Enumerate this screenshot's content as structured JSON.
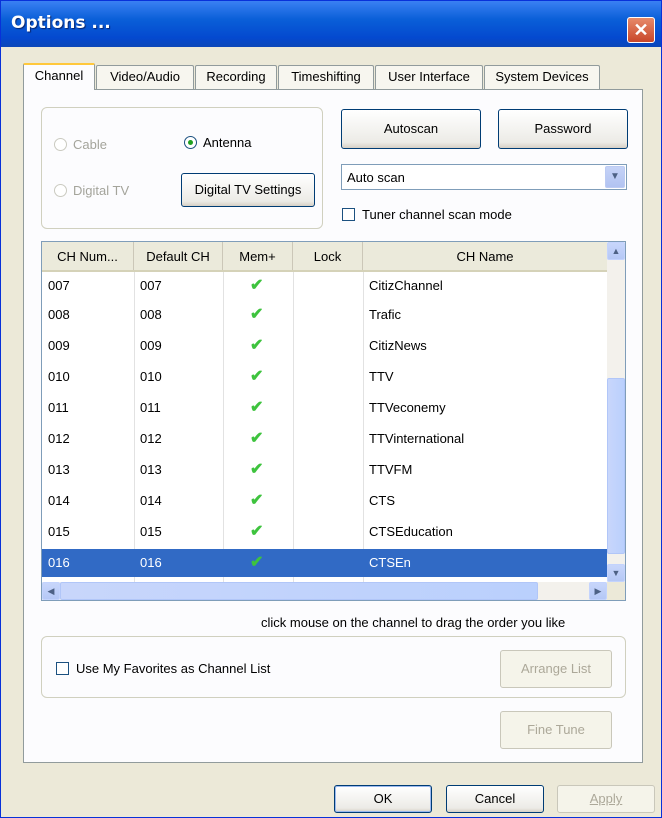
{
  "window": {
    "title": "Options ..."
  },
  "tabs": [
    "Channel",
    "Video/Audio",
    "Recording",
    "Timeshifting",
    "User Interface",
    "System Devices"
  ],
  "source": {
    "cable_label": "Cable",
    "antenna_label": "Antenna",
    "digital_tv_label": "Digital TV",
    "selected": "Antenna",
    "digital_tv_settings_label": "Digital TV Settings"
  },
  "buttons": {
    "autoscan": "Autoscan",
    "password": "Password",
    "arrange_list": "Arrange List",
    "fine_tune": "Fine Tune",
    "ok": "OK",
    "cancel": "Cancel",
    "apply": "Apply"
  },
  "scan": {
    "mode_value": "Auto scan",
    "tuner_scan_label": "Tuner channel scan mode"
  },
  "list": {
    "columns": [
      "CH Num...",
      "Default CH",
      "Mem+",
      "Lock",
      "CH Name"
    ],
    "rows": [
      {
        "ch": "007",
        "default": "007",
        "mem": true,
        "lock": "",
        "name": "CitizChannel"
      },
      {
        "ch": "008",
        "default": "008",
        "mem": true,
        "lock": "",
        "name": "Trafic"
      },
      {
        "ch": "009",
        "default": "009",
        "mem": true,
        "lock": "",
        "name": "CitizNews"
      },
      {
        "ch": "010",
        "default": "010",
        "mem": true,
        "lock": "",
        "name": "TTV"
      },
      {
        "ch": "011",
        "default": "011",
        "mem": true,
        "lock": "",
        "name": "TTVeconemy"
      },
      {
        "ch": "012",
        "default": "012",
        "mem": true,
        "lock": "",
        "name": "TTVinternational"
      },
      {
        "ch": "013",
        "default": "013",
        "mem": true,
        "lock": "",
        "name": "TTVFM"
      },
      {
        "ch": "014",
        "default": "014",
        "mem": true,
        "lock": "",
        "name": "CTS"
      },
      {
        "ch": "015",
        "default": "015",
        "mem": true,
        "lock": "",
        "name": "CTSEducation"
      },
      {
        "ch": "016",
        "default": "016",
        "mem": true,
        "lock": "",
        "name": "CTSEn"
      }
    ],
    "selected_row": "016",
    "hint": "click mouse on the channel to drag the order you like"
  },
  "favorites": {
    "label": "Use My Favorites as Channel List",
    "checked": false
  },
  "icons": {
    "close": "close-icon",
    "check": "check-icon",
    "dropdown": "chevron-down-icon"
  },
  "colors": {
    "selection": "#316ac5",
    "check": "#3ec33e",
    "title_bar": "#0a5fd8"
  }
}
